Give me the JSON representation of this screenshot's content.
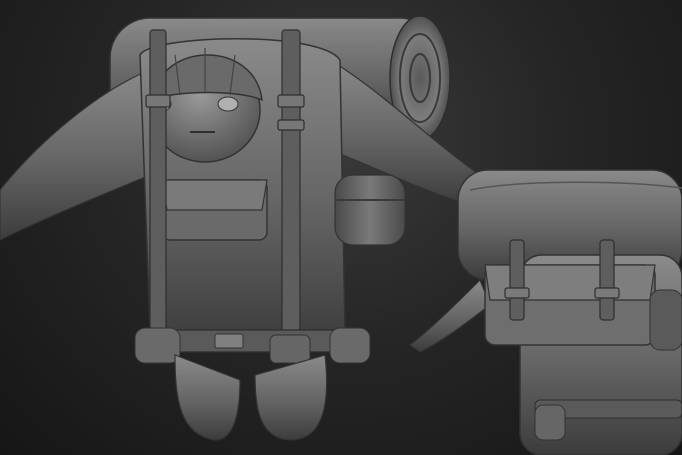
{
  "scene": {
    "subject": "",
    "background_color": "#1e1e1e",
    "material_color": "#6e6e6e",
    "highlight_color": "#a0a0a0",
    "shadow_color": "#2a2a2a",
    "views": [
      {
        "view": "front"
      },
      {
        "view": "back"
      }
    ]
  }
}
